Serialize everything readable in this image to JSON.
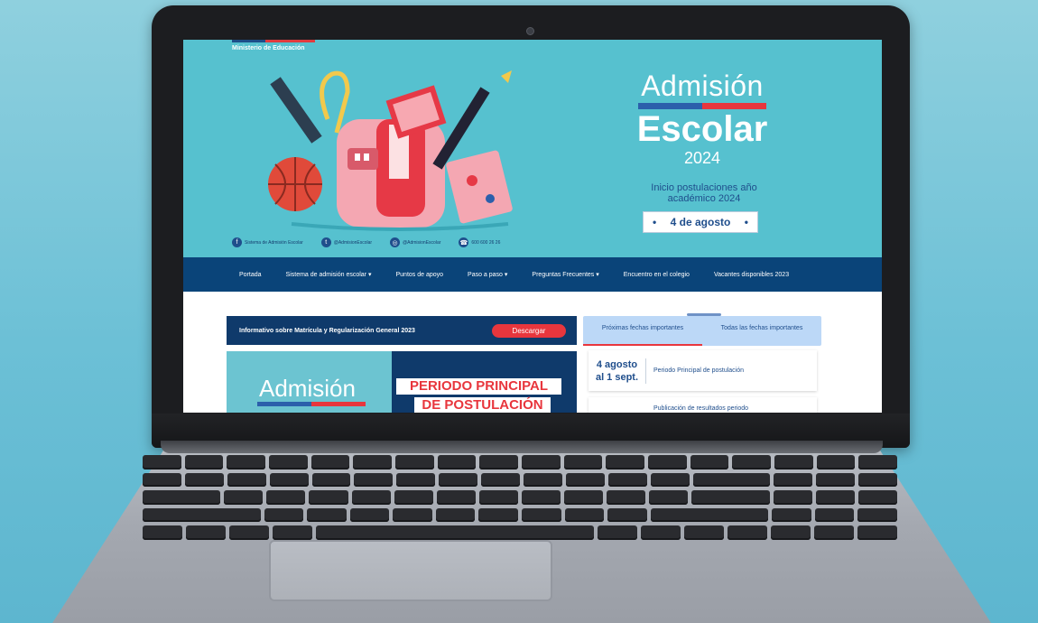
{
  "site": {
    "ministry": "Ministerio de Educación",
    "brand_title": "Admisión",
    "brand_subtitle": "Escolar",
    "brand_year": "2024",
    "tagline": "Inicio postulaciones año académico 2024",
    "date_pill": "4 de agosto",
    "date_pill_bullet": "•"
  },
  "socials": [
    {
      "icon": "facebook-icon",
      "glyph": "f",
      "label": "Sistema de Admisión Escolar"
    },
    {
      "icon": "twitter-icon",
      "glyph": "t",
      "label": "@AdmisionEscolar"
    },
    {
      "icon": "instagram-icon",
      "glyph": "◎",
      "label": "@AdmisionEscolar"
    },
    {
      "icon": "phone-icon",
      "glyph": "☎",
      "label": "600 600 26 26"
    }
  ],
  "nav": {
    "items": [
      {
        "label": "Portada"
      },
      {
        "label": "Sistema de admisión escolar ▾"
      },
      {
        "label": "Puntos de apoyo"
      },
      {
        "label": "Paso a paso ▾"
      },
      {
        "label": "Preguntas Frecuentes ▾"
      },
      {
        "label": "Encuentro en el colegio"
      },
      {
        "label": "Vacantes disponibles 2023"
      }
    ]
  },
  "info_bar": {
    "text": "Informativo sobre Matrícula y Regularización General 2023",
    "button": "Descargar"
  },
  "banner": {
    "left_title": "Admisión",
    "line1": "PERIODO PRINCIPAL",
    "line2": "DE POSTULACIÓN"
  },
  "tabs": [
    {
      "label": "Próximas fechas importantes",
      "active": true
    },
    {
      "label": "Todas las fechas importantes",
      "active": false
    }
  ],
  "events": [
    {
      "date": "4 agosto al 1 sept.",
      "desc": "Periodo Principal de postulación"
    },
    {
      "date": "",
      "desc": "Publicación de resultados periodo"
    }
  ],
  "colors": {
    "hero": "#56c1cf",
    "nav": "#0a4479",
    "accent_red": "#e8363d",
    "accent_blue": "#1f4e8c"
  }
}
